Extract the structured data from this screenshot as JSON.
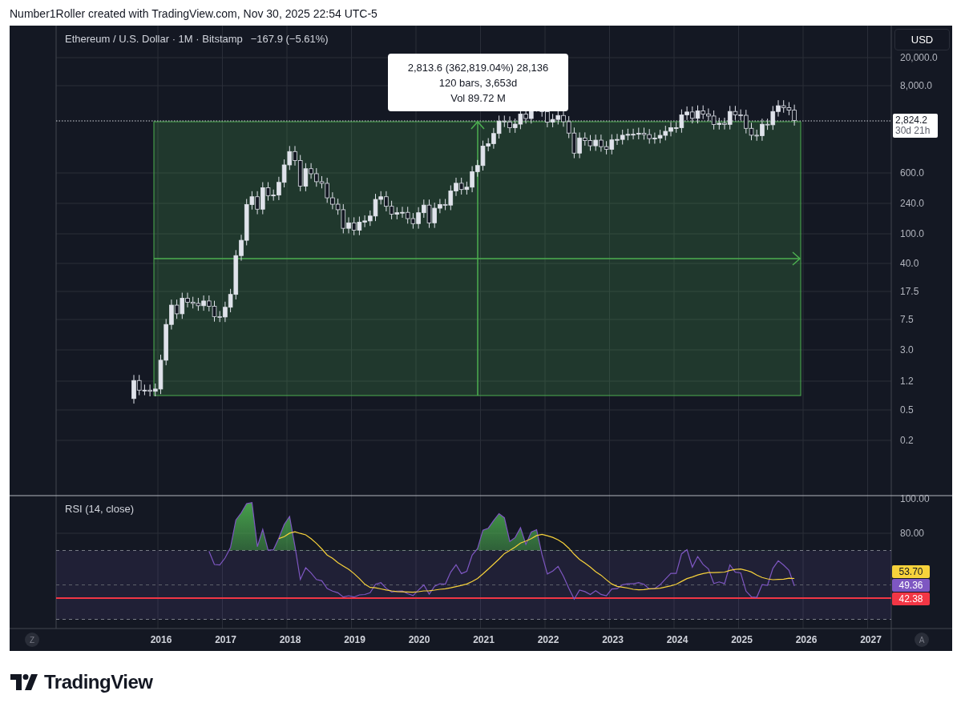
{
  "attribution": "Number1Roller created with TradingView.com, Nov 30, 2025 22:54 UTC-5",
  "chart": {
    "legend": {
      "symbol": "Ethereum / U.S. Dollar · 1M · Bitstamp",
      "change": "−167.9 (−5.61%)"
    },
    "currency_button": "USD",
    "price_axis": [
      "20,000.0",
      "8,000.0",
      "600.0",
      "240.0",
      "100.0",
      "40.0",
      "17.5",
      "7.5",
      "3.0",
      "1.2",
      "0.5",
      "0.2"
    ],
    "last_price": {
      "price": "2,824.2",
      "countdown": "30d 21h"
    },
    "measure_tooltip": [
      "2,813.6 (362,819.04%) 28,136",
      "120 bars, 3,653d",
      "Vol 89.72 M"
    ]
  },
  "rsi": {
    "title": "RSI (14, close)",
    "axis": [
      "100.00",
      "80.00"
    ],
    "values": [
      {
        "text": "53.70",
        "color": "#f7d23b"
      },
      {
        "text": "49.36",
        "color": "#7e57c2"
      },
      {
        "text": "42.38",
        "color": "#f23645"
      }
    ]
  },
  "time_axis": {
    "left_button": "Z",
    "years": [
      "2016",
      "2017",
      "2018",
      "2019",
      "2020",
      "2021",
      "2022",
      "2023",
      "2024",
      "2025",
      "2026",
      "2027"
    ],
    "right_button": "A"
  },
  "footer": {
    "logo": "TradingView"
  }
}
